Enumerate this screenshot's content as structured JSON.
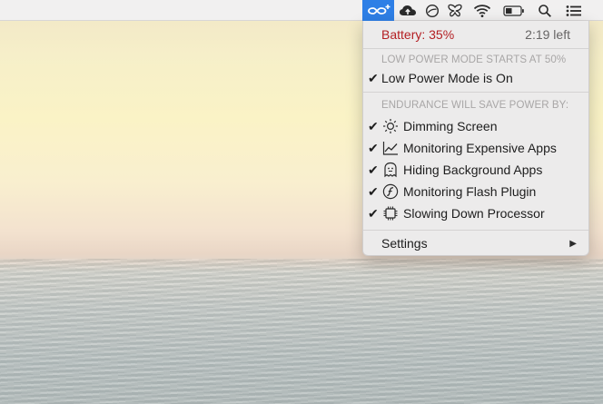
{
  "menubar": {
    "icons": [
      {
        "name": "endurance-infinity-icon",
        "active": true
      },
      {
        "name": "cloud-upload-icon"
      },
      {
        "name": "do-not-disturb-icon"
      },
      {
        "name": "butterfly-icon"
      },
      {
        "name": "wifi-icon"
      },
      {
        "name": "battery-icon"
      },
      {
        "name": "spotlight-search-icon"
      },
      {
        "name": "notification-center-icon"
      }
    ],
    "accent_color": "#2e7fe6"
  },
  "menu": {
    "battery_label": "Battery: 35%",
    "time_left": "2:19 left",
    "battery_color": "#b41f23",
    "low_power_header": "LOW POWER MODE STARTS AT 50%",
    "low_power_item": "Low Power Mode is On",
    "savings_header": "ENDURANCE WILL SAVE POWER BY:",
    "savings_items": [
      {
        "label": "Dimming Screen",
        "icon": "sun-icon",
        "checked": true
      },
      {
        "label": "Monitoring Expensive Apps",
        "icon": "chart-icon",
        "checked": true
      },
      {
        "label": "Hiding Background Apps",
        "icon": "ghost-icon",
        "checked": true
      },
      {
        "label": "Monitoring Flash Plugin",
        "icon": "flash-icon",
        "checked": true
      },
      {
        "label": "Slowing Down Processor",
        "icon": "cpu-chip-icon",
        "checked": true
      }
    ],
    "settings_label": "Settings"
  }
}
